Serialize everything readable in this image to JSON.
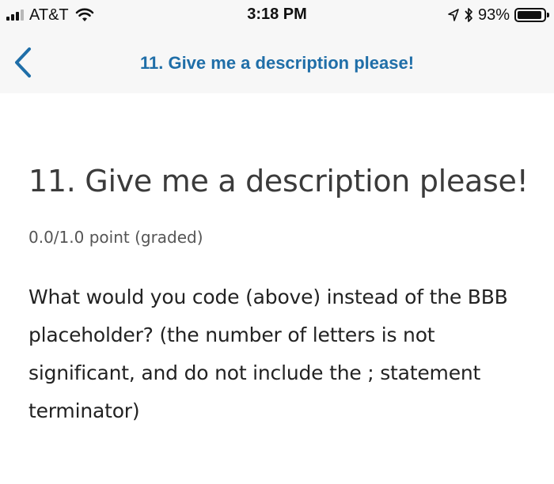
{
  "status_bar": {
    "carrier": "AT&T",
    "time": "3:18 PM",
    "battery_percent": "93%",
    "battery_level": 0.93,
    "signal_bars_filled": 3,
    "icons": [
      "signal-icon",
      "wifi-icon",
      "location-icon",
      "bluetooth-icon",
      "battery-icon"
    ]
  },
  "nav": {
    "title": "11. Give me a description please!",
    "back_icon": "chevron-left-icon"
  },
  "question": {
    "title": "11. Give me a description please!",
    "points": "0.0/1.0 point (graded)",
    "body": "What would you code (above) instead of the BBB placeholder? (the number of letters is not significant, and do not include the ; statement terminator)"
  },
  "colors": {
    "accent": "#1f6ea8",
    "bar_background": "#f7f7f7"
  }
}
